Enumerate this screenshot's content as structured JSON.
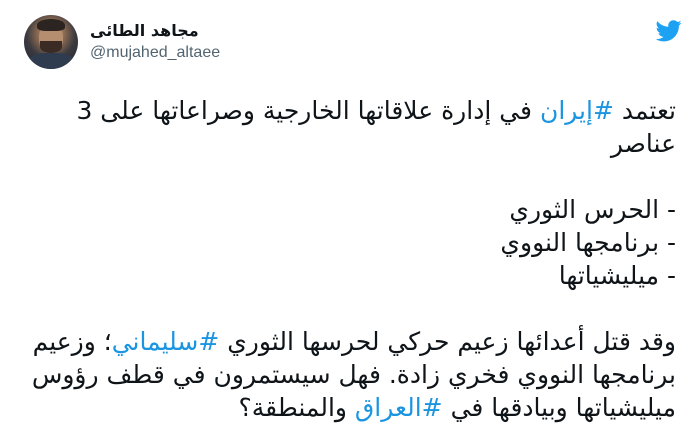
{
  "author": {
    "display_name": "مجاهد الطائى",
    "handle": "@mujahed_altaee"
  },
  "tweet": {
    "line1_a": "تعتمد ",
    "line1_hashtag": "#إيران",
    "line1_b": " في إدارة علاقاتها الخارجية وصراعاتها على 3 عناصر",
    "list": [
      "- الحرس الثوري",
      "- برنامجها النووي",
      "- ميليشياتها"
    ],
    "para_a": "وقد قتل أعدائها زعيم حركي لحرسها الثوري ",
    "para_hashtag1": "#سليماني",
    "para_b": "؛ وزعيم برنامجها النووي فخري زادة. فهل سيستمرون في قطف رؤوس ميليشياتها وبيادقها في ",
    "para_hashtag2": "#العراق",
    "para_c": " والمنطقة؟"
  },
  "colors": {
    "hashtag": "#1b95e0",
    "bird": "#1da1f2",
    "text": "#0f1419",
    "handle": "#536471"
  },
  "icons": {
    "brand": "twitter-bird-icon"
  }
}
